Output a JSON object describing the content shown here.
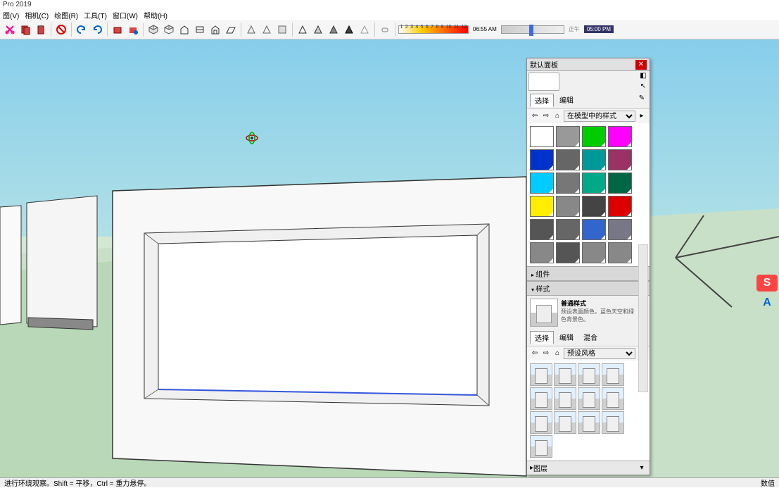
{
  "app": {
    "title": "Pro 2019"
  },
  "menu": {
    "items": [
      "图(V)",
      "相机(C)",
      "绘图(R)",
      "工具(T)",
      "窗口(W)",
      "帮助(H)"
    ]
  },
  "toolbar": {
    "time_start": "06:55 AM",
    "time_mid": "正午",
    "time_end": "05:00 PM",
    "ticks": [
      "1",
      "2",
      "3",
      "4",
      "5",
      "6",
      "7",
      "8",
      "9",
      "10",
      "11",
      "12"
    ]
  },
  "tray": {
    "title": "默认面板",
    "materials": {
      "tab_select": "选择",
      "tab_edit": "编辑",
      "combo_label": "在模型中的样式",
      "colors": [
        "#ffffff",
        "#999999",
        "#00cc00",
        "#ff00ff",
        "#0033cc",
        "#666666",
        "#009999",
        "#993366",
        "#00ccff",
        "#777777",
        "#00aa88",
        "#006644",
        "#ffee00",
        "#888888",
        "#444444",
        "#dd0000",
        "#555555",
        "#666666",
        "#3366cc",
        "#777788",
        "#888888",
        "#555555",
        "#888888",
        "#888888"
      ]
    },
    "components_header": "组件",
    "styles_header": "样式",
    "style": {
      "name": "普通样式",
      "desc": "预设表面颜色，蓝色天空和绿色背景色。"
    },
    "styles_tabs": {
      "select": "选择",
      "edit": "编辑",
      "mix": "混合"
    },
    "styles_combo": "预设风格",
    "layers_header": "图层"
  },
  "status": {
    "left": "进行环绕观察。Shift = 平移，Ctrl = 重力悬停。",
    "right": "数值"
  }
}
